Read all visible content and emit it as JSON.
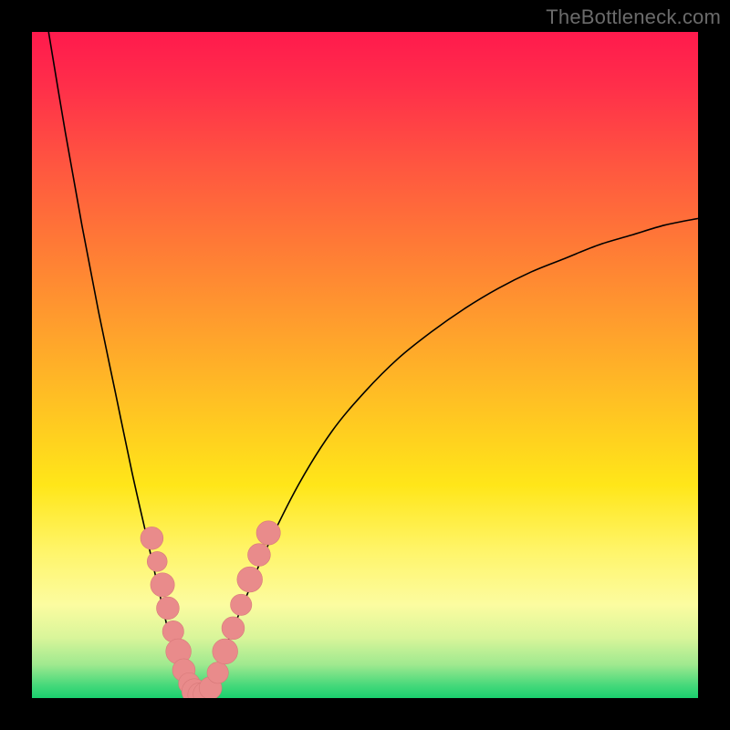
{
  "watermark": "TheBottleneck.com",
  "colors": {
    "frame": "#000000",
    "curve": "#000000",
    "dot_fill": "#e98b8b",
    "dot_stroke": "#d87a7a",
    "gradient_stops": [
      {
        "pos": 0.0,
        "color": "#ff1a4d"
      },
      {
        "pos": 0.08,
        "color": "#ff2e4a"
      },
      {
        "pos": 0.2,
        "color": "#ff5640"
      },
      {
        "pos": 0.32,
        "color": "#ff7a36"
      },
      {
        "pos": 0.44,
        "color": "#ff9e2d"
      },
      {
        "pos": 0.56,
        "color": "#ffc223"
      },
      {
        "pos": 0.68,
        "color": "#ffe619"
      },
      {
        "pos": 0.78,
        "color": "#fff56a"
      },
      {
        "pos": 0.86,
        "color": "#fcfca0"
      },
      {
        "pos": 0.91,
        "color": "#d8f59a"
      },
      {
        "pos": 0.95,
        "color": "#9fe98f"
      },
      {
        "pos": 0.98,
        "color": "#48d97b"
      },
      {
        "pos": 1.0,
        "color": "#19cf6e"
      }
    ]
  },
  "chart_data": {
    "type": "line",
    "title": "",
    "xlabel": "",
    "ylabel": "",
    "xlim": [
      0,
      100
    ],
    "ylim": [
      0,
      100
    ],
    "series": [
      {
        "name": "left-branch",
        "x": [
          2.5,
          5,
          7.5,
          10,
          12.5,
          15,
          17.5,
          20,
          21,
          22,
          23,
          24,
          25
        ],
        "y": [
          100,
          85,
          71,
          58,
          46,
          34,
          23,
          12,
          8,
          5,
          2.5,
          1,
          0
        ]
      },
      {
        "name": "right-branch",
        "x": [
          25,
          26,
          27,
          28,
          30,
          32.5,
          35,
          40,
          45,
          50,
          55,
          60,
          65,
          70,
          75,
          80,
          85,
          90,
          95,
          100
        ],
        "y": [
          0,
          1.2,
          3,
          5,
          10,
          16,
          22,
          32,
          40,
          46,
          51,
          55,
          58.5,
          61.5,
          64,
          66,
          68,
          69.5,
          71,
          72
        ]
      }
    ],
    "scatter_points": {
      "name": "dots",
      "points": [
        {
          "x": 18.0,
          "y": 24.0,
          "r": 1.7
        },
        {
          "x": 18.8,
          "y": 20.5,
          "r": 1.5
        },
        {
          "x": 19.6,
          "y": 17.0,
          "r": 1.8
        },
        {
          "x": 20.4,
          "y": 13.5,
          "r": 1.7
        },
        {
          "x": 21.2,
          "y": 10.0,
          "r": 1.6
        },
        {
          "x": 22.0,
          "y": 7.0,
          "r": 1.9
        },
        {
          "x": 22.8,
          "y": 4.2,
          "r": 1.7
        },
        {
          "x": 23.6,
          "y": 2.2,
          "r": 1.6
        },
        {
          "x": 24.4,
          "y": 1.0,
          "r": 1.9
        },
        {
          "x": 25.2,
          "y": 0.5,
          "r": 1.8
        },
        {
          "x": 26.0,
          "y": 0.6,
          "r": 1.8
        },
        {
          "x": 26.8,
          "y": 1.5,
          "r": 1.7
        },
        {
          "x": 27.9,
          "y": 3.8,
          "r": 1.6
        },
        {
          "x": 29.0,
          "y": 7.0,
          "r": 1.9
        },
        {
          "x": 30.2,
          "y": 10.5,
          "r": 1.7
        },
        {
          "x": 31.4,
          "y": 14.0,
          "r": 1.6
        },
        {
          "x": 32.7,
          "y": 17.8,
          "r": 1.9
        },
        {
          "x": 34.1,
          "y": 21.5,
          "r": 1.7
        },
        {
          "x": 35.5,
          "y": 24.8,
          "r": 1.8
        }
      ]
    }
  }
}
